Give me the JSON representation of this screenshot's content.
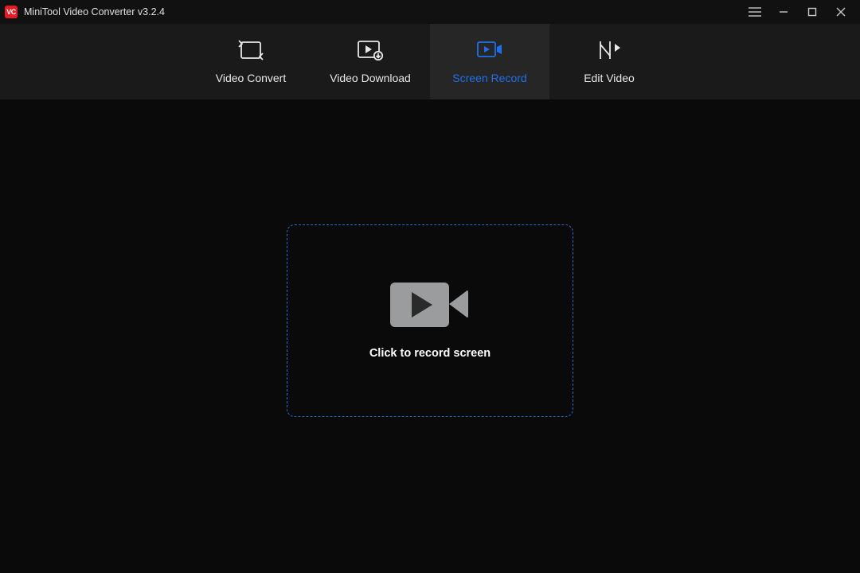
{
  "titlebar": {
    "app_badge": "VC",
    "title": "MiniTool Video Converter v3.2.4"
  },
  "tabs": {
    "items": [
      {
        "label": "Video Convert"
      },
      {
        "label": "Video Download"
      },
      {
        "label": "Screen Record"
      },
      {
        "label": "Edit Video"
      }
    ],
    "active_index": 2
  },
  "main": {
    "record_label": "Click to record screen"
  }
}
